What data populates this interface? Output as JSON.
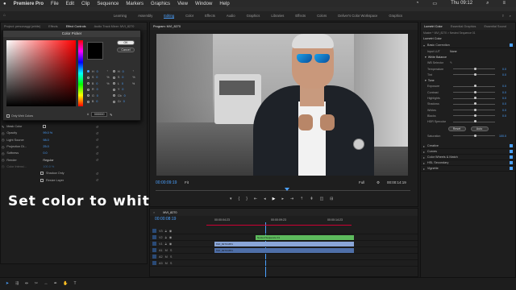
{
  "macbar": {
    "app": "Premiere Pro",
    "menus": [
      "File",
      "Edit",
      "Clip",
      "Sequence",
      "Markers",
      "Graphics",
      "View",
      "Window",
      "Help"
    ],
    "clock": "Thu 09:12"
  },
  "workspaces": {
    "items": [
      "Learning",
      "Assembly",
      "Editing",
      "Color",
      "Effects",
      "Audio",
      "Graphics",
      "Libraries",
      "Effects",
      "Colors",
      "Deliver's Color Workspace",
      "Graphics"
    ],
    "active_index": 2
  },
  "left_panel": {
    "tabs": [
      "Project: personaggi (white)",
      "Effects",
      "Effect Controls",
      "Audio Track Mixer: MVI_8270"
    ],
    "active_tab": 2
  },
  "color_picker": {
    "title": "Color Picker",
    "ok_label": "OK",
    "cancel_label": "Cancel",
    "fields": [
      {
        "name": "H",
        "value": "0",
        "unit": "°"
      },
      {
        "name": "S",
        "value": "0",
        "unit": "%"
      },
      {
        "name": "B",
        "value": "0",
        "unit": "%"
      },
      {
        "name": "R",
        "value": "0",
        "unit": ""
      },
      {
        "name": "G",
        "value": "0",
        "unit": ""
      },
      {
        "name": "B",
        "value": "0",
        "unit": ""
      }
    ],
    "fields_right": [
      {
        "name": "H",
        "value": "0",
        "unit": "°"
      },
      {
        "name": "S",
        "value": "0",
        "unit": "%"
      },
      {
        "name": "L",
        "value": "0",
        "unit": "%"
      },
      {
        "name": "Y",
        "value": "0",
        "unit": ""
      },
      {
        "name": "Cb",
        "value": "0",
        "unit": ""
      },
      {
        "name": "Cr",
        "value": "0",
        "unit": ""
      }
    ],
    "hex_prefix": "#",
    "hex_value": "000000",
    "web_colors_label": "Only Web Colors",
    "current_color": "#000000"
  },
  "effects": [
    {
      "label": "Mask Color",
      "value": ""
    },
    {
      "label": "Opacity",
      "value": "99.0 %"
    },
    {
      "label": "Light Source",
      "value": "98.0"
    },
    {
      "label": "Projection Di...",
      "value": "25.0"
    },
    {
      "label": "Softness",
      "value": "0.0"
    },
    {
      "label": "Render",
      "value": "Regular"
    },
    {
      "label": "Color Intensi...",
      "value": "100.0 %"
    },
    {
      "label": "",
      "value": "Shadow Only"
    },
    {
      "label": "",
      "value": "Resize Layer"
    }
  ],
  "caption": "Set color to white",
  "program_monitor": {
    "title": "Program: MVI_8270",
    "timecode_in": "00:00:09:19",
    "fit": "Fit",
    "quality": "Full",
    "duration": "00:00:14:19"
  },
  "timeline": {
    "tab": "MVI_8270",
    "timecode": "00:00:08:19",
    "ruler": [
      "00:00:04:23",
      "00:00:09:23",
      "00:00:14:23"
    ],
    "tracks": [
      "V3",
      "V2",
      "V1",
      "A1",
      "A2",
      "A3"
    ],
    "clips": [
      {
        "label": "Nested Sequence 01",
        "track": "V2",
        "color": "#5dbb5d"
      },
      {
        "label": "MVI_8270.MP4",
        "track": "V1",
        "color": "#8aa6d8"
      },
      {
        "label": "MVI_8270.MP4",
        "track": "A1",
        "color": "#8aa6d8"
      }
    ]
  },
  "lumetri": {
    "tabs": [
      "Lumetri Color",
      "Essential Graphics",
      "Essential Sound"
    ],
    "source": "Master * MVI_8270 > Nested Sequence 01",
    "effect": "Lumetri Color",
    "sections": [
      {
        "name": "Basic Correction",
        "checked": true
      },
      {
        "name": "Creative",
        "checked": true
      },
      {
        "name": "Curves",
        "checked": true
      },
      {
        "name": "Color Wheels & Match",
        "checked": true
      },
      {
        "name": "HSL Secondary",
        "checked": true
      },
      {
        "name": "Vignette",
        "checked": true
      }
    ],
    "input_lut_label": "Input LUT",
    "input_lut_value": "None",
    "white_balance_label": "White Balance",
    "wb_selector_label": "WB Selector",
    "wb_rows": [
      {
        "label": "Temperature",
        "value": "0.0",
        "pos": 0.5
      },
      {
        "label": "Tint",
        "value": "0.0",
        "pos": 0.5
      }
    ],
    "tone_label": "Tone",
    "tone_rows": [
      {
        "label": "Exposure",
        "value": "0.0",
        "pos": 0.5
      },
      {
        "label": "Contrast",
        "value": "0.0",
        "pos": 0.5
      },
      {
        "label": "Highlights",
        "value": "0.0",
        "pos": 0.5
      },
      {
        "label": "Shadows",
        "value": "0.0",
        "pos": 0.5
      },
      {
        "label": "Whites",
        "value": "0.0",
        "pos": 0.5
      },
      {
        "label": "Blacks",
        "value": "0.0",
        "pos": 0.5
      },
      {
        "label": "HDR Specular",
        "value": "",
        "pos": 0.5
      }
    ],
    "reset_label": "Reset",
    "auto_label": "Auto",
    "saturation_label": "Saturation",
    "saturation_value": "100.0",
    "saturation_pos": 0.5
  },
  "colors": {
    "accent": "#4ba1ff",
    "panel": "#1e1e1e",
    "clip_green": "#5dbb5d",
    "clip_blue": "#8aa6d8"
  }
}
